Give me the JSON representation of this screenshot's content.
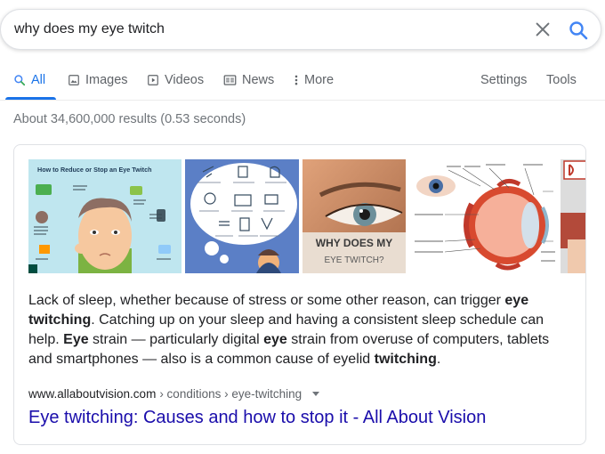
{
  "search": {
    "query": "why does my eye twitch"
  },
  "tabs": [
    {
      "label": "All",
      "icon": "search-icon"
    },
    {
      "label": "Images",
      "icon": "image-icon"
    },
    {
      "label": "Videos",
      "icon": "video-icon"
    },
    {
      "label": "News",
      "icon": "news-icon"
    },
    {
      "label": "More",
      "icon": "more-vert-icon"
    }
  ],
  "tools": {
    "settings": "Settings",
    "tools": "Tools"
  },
  "stats": "About 34,600,000 results (0.53 seconds)",
  "images": {
    "img1_title": "How to Reduce or Stop an Eye Twitch",
    "img3_line1": "WHY DOES MY",
    "img3_line2": "EYE TWITCH?"
  },
  "snippet": {
    "s1": "Lack of sleep, whether because of stress or some other reason, can trigger ",
    "b1": "eye twitching",
    "s2": ". Catching up on your sleep and having a consistent sleep schedule can help. ",
    "b2": "Eye",
    "s3": " strain — particularly digital ",
    "b3": "eye",
    "s4": " strain from overuse of computers, tablets and smartphones — also is a common cause of eyelid ",
    "b4": "twitching",
    "s5": "."
  },
  "result": {
    "domain": "www.allaboutvision.com",
    "breadcrumb": " › conditions › eye-twitching",
    "title": "Eye twitching: Causes and how to stop it - All About Vision"
  },
  "colors": {
    "accent": "#1a73e8",
    "link": "#1a0dab",
    "muted": "#70757a"
  }
}
